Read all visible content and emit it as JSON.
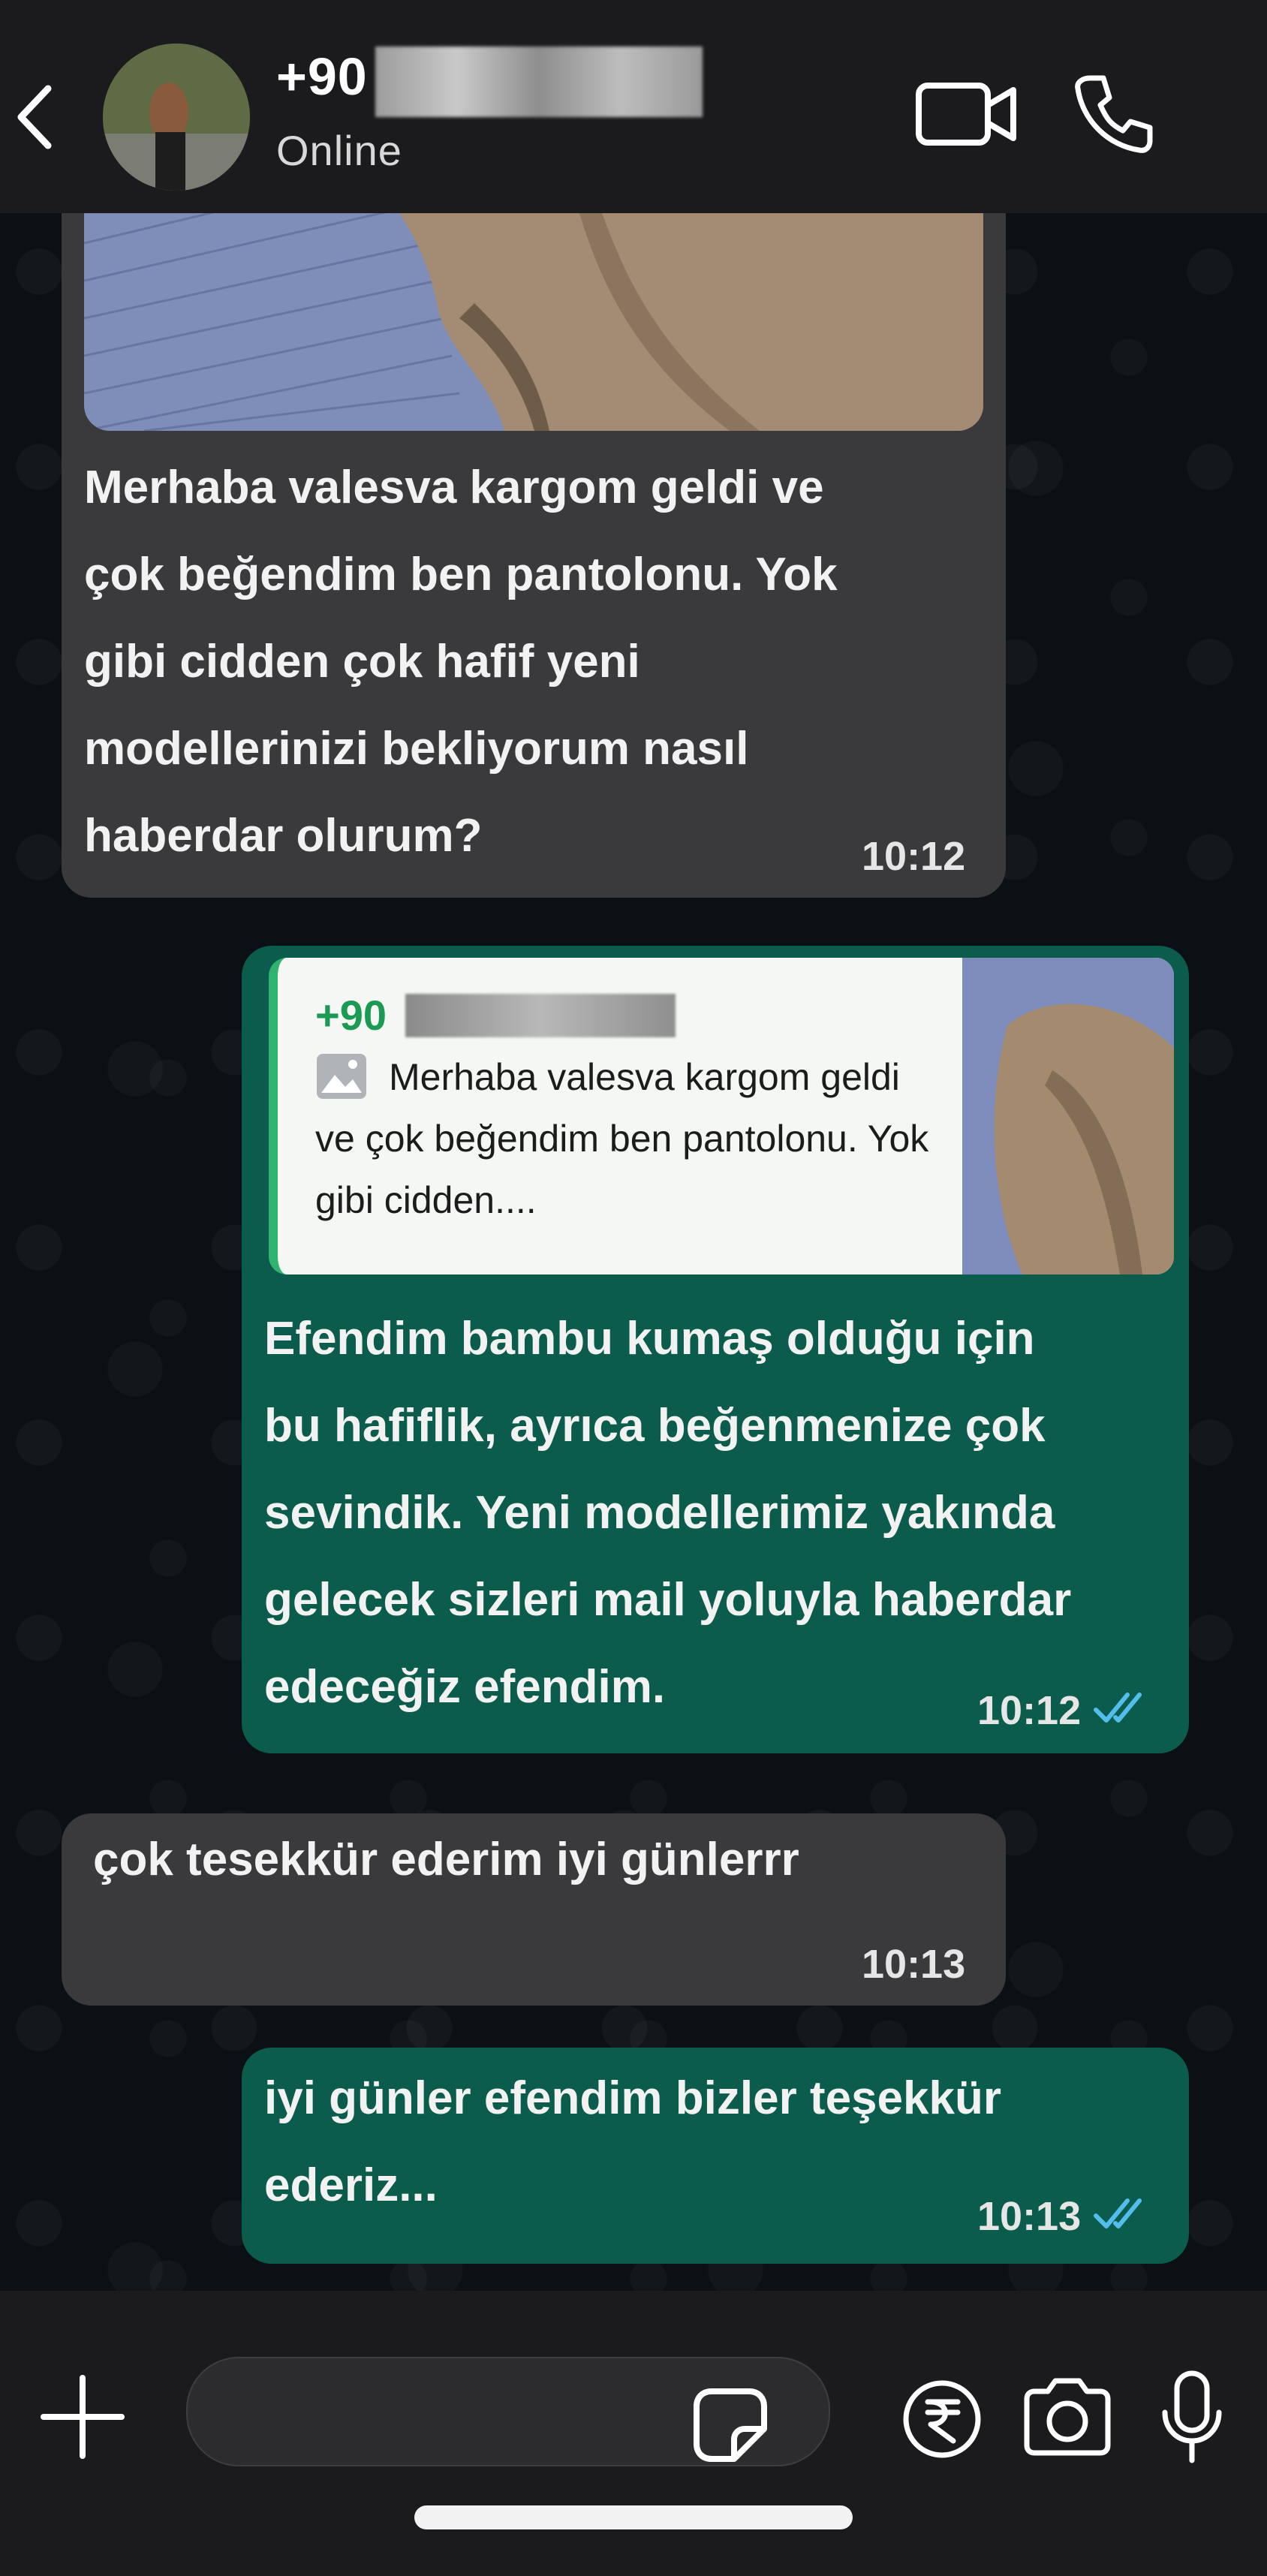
{
  "header": {
    "contact_name": "+90",
    "status": "Online"
  },
  "messages": [
    {
      "direction": "incoming",
      "has_image": true,
      "text": "Merhaba valesva kargom geldi ve\nçok beğendim ben pantolonu. Yok\ngibi cidden çok hafif yeni\nmodellerinizi bekliyorum nasıl\nhaberdar olurum?",
      "time": "10:12"
    },
    {
      "direction": "outgoing",
      "reply": {
        "sender": "+90",
        "text": "Merhaba valesva kargom geldi ve çok beğendim ben pantolonu. Yok gibi cidden...."
      },
      "text": "Efendim bambu kumaş olduğu için\nbu hafiflik, ayrıca beğenmenize çok\nsevindik. Yeni modellerimiz yakında\ngelecek sizleri mail yoluyla haberdar\nedeceğiz efendim.",
      "time": "10:12",
      "status": "read"
    },
    {
      "direction": "incoming",
      "text": "çok tesekkür ederim iyi günlerrr",
      "time": "10:13"
    },
    {
      "direction": "outgoing",
      "text": "iyi günler efendim bizler teşekkür\nederiz...",
      "time": "10:13",
      "status": "read"
    }
  ],
  "composer": {
    "placeholder": ""
  },
  "colors": {
    "incoming_bubble": "#3a3a3c",
    "outgoing_bubble": "#0b5c4d",
    "read_ticks": "#53bdeb",
    "reply_accent": "#2fb36e"
  }
}
